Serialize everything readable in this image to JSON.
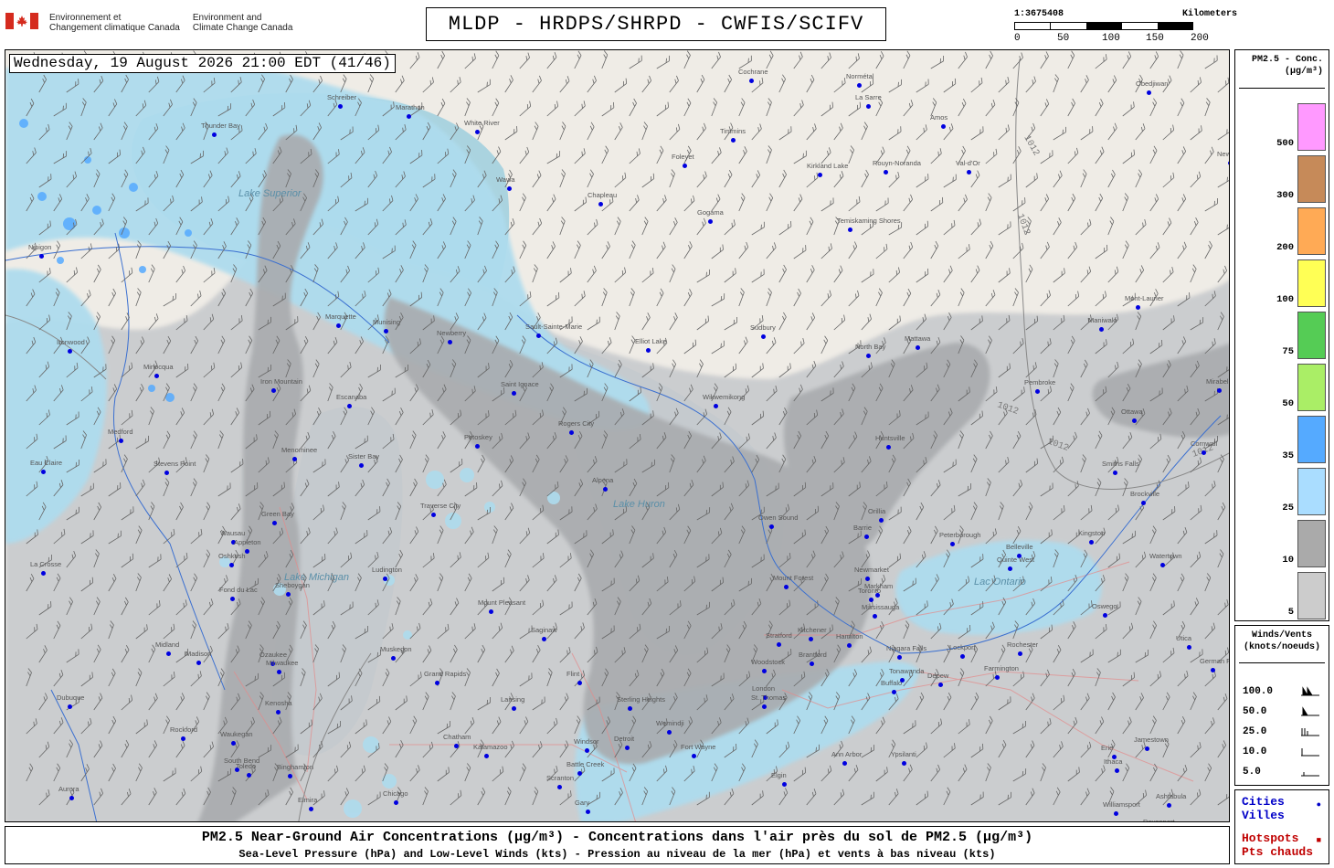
{
  "header": {
    "gov_fr": [
      "Environnement et",
      "Changement climatique Canada"
    ],
    "gov_en": [
      "Environment and",
      "Climate Change Canada"
    ],
    "title": "MLDP - HRDPS/SHRPD - CWFIS/SCIFV",
    "scale_ratio": "1:3675408",
    "scale_unit": "Kilometers",
    "scale_ticks": [
      "0",
      "50",
      "100",
      "150",
      "200"
    ]
  },
  "map": {
    "timestamp": "Wednesday, 19 August 2026 21:00 EDT (41/46)",
    "lake_labels": [
      "Lake Superior",
      "Lake Huron",
      "Lake Michigan",
      "Lac Ontario"
    ],
    "cities": [
      "Cochrane",
      "Normétal",
      "Obedjiwan",
      "La Sarre",
      "Amos",
      "Schreiber",
      "Marathon",
      "White River",
      "Timmins",
      "Thunder Bay",
      "Foleyet",
      "Kirkland Lake",
      "Rouyn-Noranda",
      "Val-d'Or",
      "Wawa",
      "Chapleau",
      "Gogama",
      "Temiskaming Shores",
      "Nipigon",
      "Marquette",
      "Munising",
      "Newberry",
      "Sault-Sainte-Marie",
      "Elliot Lake",
      "Sudbury",
      "North Bay",
      "Mattawa",
      "Maniwaki",
      "Mont-Laurier",
      "Ironwood",
      "Iron Mountain",
      "Escanaba",
      "Saint Ignace",
      "Wikwemikong",
      "Pembroke",
      "Mirabel",
      "Ottawa",
      "Cornwall",
      "Minocqua",
      "Medford",
      "Menominee",
      "Sister Bay",
      "Petoskey",
      "Rogers City",
      "Huntsville",
      "Alpena",
      "Smiths Falls",
      "Brockville",
      "Eau Claire",
      "Stevens Point",
      "Green Bay",
      "Traverse City",
      "Owen Sound",
      "Orillia",
      "Barrie",
      "Peterborough",
      "Belleville",
      "Kingston",
      "Wausau",
      "Appleton",
      "Oshkosh",
      "Ludington",
      "Quinte West",
      "Watertown",
      "La Crosse",
      "Fond du Lac",
      "Sheboygan",
      "Midland",
      "Mount Pleasant",
      "Mount Forest",
      "Newmarket",
      "Markham",
      "Toronto",
      "Mississauga",
      "Oswego",
      "Saginaw",
      "Madison",
      "Ozaukee",
      "Milwaukee",
      "Muskegon",
      "Kitchener",
      "Hamilton",
      "Stratford",
      "Brantford",
      "Niagara Falls",
      "Lockport",
      "Rochester",
      "Utica",
      "German Flatts",
      "Grand Rapids",
      "Flint",
      "Lansing",
      "Woodstock",
      "London",
      "Tonawanda",
      "Buffalo",
      "Depew",
      "Farmington",
      "Dubuque",
      "Kenosha",
      "Rockford",
      "Waukegan",
      "Sterling Heights",
      "St. Thomas",
      "Detroit",
      "Windsor",
      "Chatham",
      "Kalamazoo",
      "Battle Creek",
      "Ann Arbor",
      "Ypsilanti",
      "Erie",
      "Jamestown",
      "Ithaca",
      "Binghamton",
      "Elmira",
      "Chicago",
      "Gary",
      "South Bend",
      "Toledo",
      "Aurora",
      "Elgin",
      "Davenport",
      "Ashtabula",
      "Williamsport",
      "Scranton",
      "New York",
      "Fort Wayne",
      "Wemindji",
      "Lexington",
      "Sarnia"
    ],
    "isobar_labels": [
      "1012",
      "1012",
      "1012",
      "1012",
      "1012"
    ]
  },
  "legend_pm": {
    "title": [
      "PM2.5 - Conc.",
      "(µg/m³)"
    ],
    "levels": [
      {
        "label": "500",
        "color": "#ff99ff"
      },
      {
        "label": "300",
        "color": "#c68a59"
      },
      {
        "label": "200",
        "color": "#ffaa55"
      },
      {
        "label": "100",
        "color": "#ffff55"
      },
      {
        "label": "75",
        "color": "#55cc55"
      },
      {
        "label": "50",
        "color": "#aaee66"
      },
      {
        "label": "35",
        "color": "#55aaff"
      },
      {
        "label": "25",
        "color": "#aaddff"
      },
      {
        "label": "10",
        "color": "#aaaaaa"
      },
      {
        "label": "5",
        "color": "#cccccc"
      }
    ]
  },
  "legend_wind": {
    "title": [
      "Winds/Vents",
      "(knots/noeuds)"
    ],
    "rows": [
      "100.0",
      "50.0",
      "25.0",
      "10.0",
      "5.0"
    ]
  },
  "legend_cities": {
    "cities": [
      "Cities",
      "Villes"
    ],
    "hotspots": [
      "Hotspots",
      "Pts chauds"
    ]
  },
  "footer": {
    "line1": "PM2.5 Near-Ground Air Concentrations (µg/m³) - Concentrations dans l'air près du sol de PM2.5 (µg/m³)",
    "line2": "Sea-Level Pressure (hPa) and Low-Level Winds (kts) - Pression au niveau de la mer (hPa) et vents à bas niveau (kts)"
  },
  "colors": {
    "land": "#efece6",
    "lake": "#aad3df",
    "smoke_light": "#c8cacd",
    "smoke_dark": "#a9abae",
    "smoke_blue": "#aedcee",
    "smoke_mid_blue": "#55aaff",
    "city_dot": "#0000e0",
    "road": "#e48a8a",
    "border": "#3a6fd0"
  }
}
